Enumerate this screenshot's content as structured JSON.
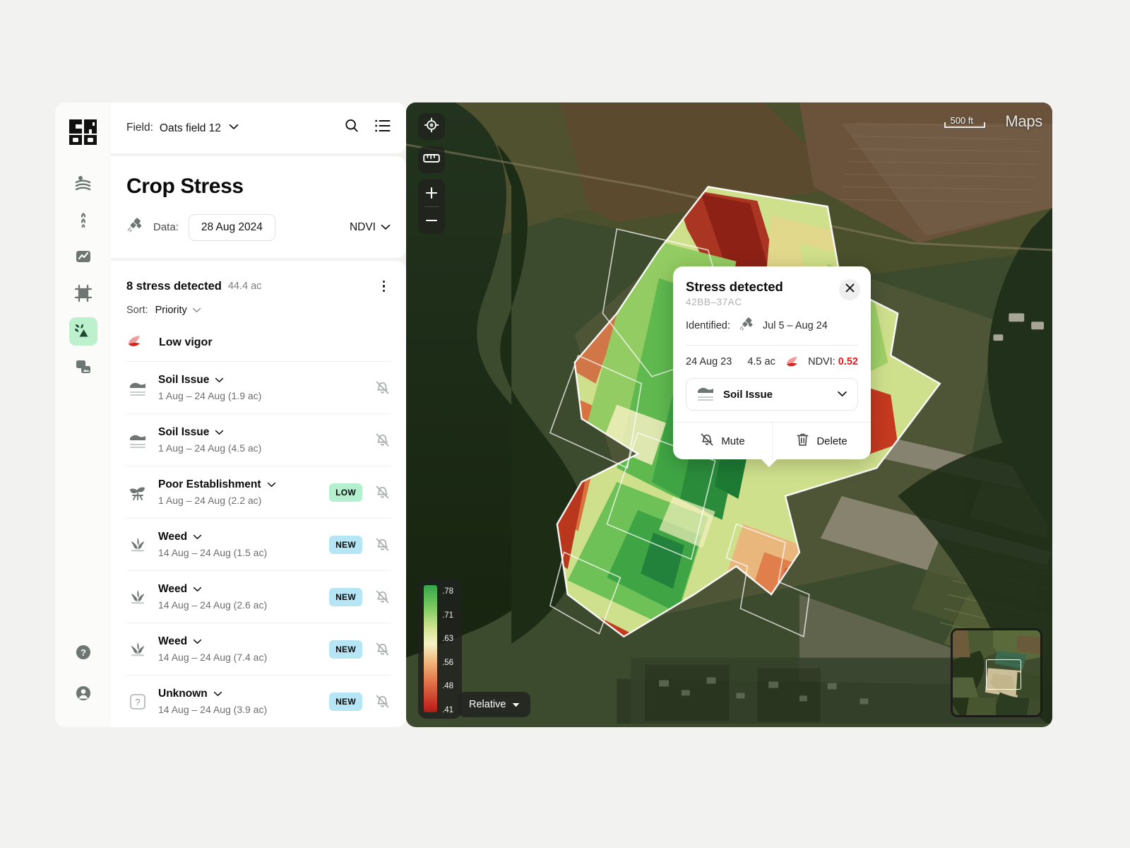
{
  "brand": {
    "logo_line1": "CR",
    "logo_line2": "OP"
  },
  "rail": {
    "items": [
      {
        "name": "fields",
        "icon": "field-rows-icon",
        "active": false
      },
      {
        "name": "crops",
        "icon": "crop-leaves-icon",
        "active": false
      },
      {
        "name": "analytics",
        "icon": "chart-line-icon",
        "active": false
      },
      {
        "name": "boundaries",
        "icon": "crop-frame-icon",
        "active": false
      },
      {
        "name": "crop-stress",
        "icon": "crop-stress-alert-icon",
        "active": true
      },
      {
        "name": "imagery",
        "icon": "layers-image-icon",
        "active": false
      }
    ],
    "bottom": [
      {
        "name": "help",
        "icon": "help-circle-icon"
      },
      {
        "name": "account",
        "icon": "user-circle-icon"
      }
    ]
  },
  "header": {
    "field_label": "Field:",
    "field_value": "Oats field 12",
    "search_icon": "search-icon",
    "list_icon": "list-view-icon"
  },
  "page": {
    "title": "Crop Stress",
    "data_label": "Data:",
    "satellite_icon": "satellite-icon",
    "date_value": "28 Aug 2024",
    "index_value": "NDVI"
  },
  "summary": {
    "count_text": "8 stress detected",
    "area_text": "44.4 ac",
    "sort_label": "Sort:",
    "sort_value": "Priority",
    "menu_icon": "kebab-menu-icon"
  },
  "group": {
    "label": "Low vigor",
    "icon": "low-vigor-leaf-icon"
  },
  "list": [
    {
      "icon": "soil-issue-icon",
      "title": "Soil Issue",
      "sub": "1 Aug – 24 Aug (1.9 ac)",
      "badge": "",
      "badge_kind": "",
      "bell": "bell-muted-icon"
    },
    {
      "icon": "soil-issue-icon",
      "title": "Soil Issue",
      "sub": "1 Aug – 24 Aug (4.5 ac)",
      "badge": "",
      "badge_kind": "",
      "bell": "bell-muted-icon"
    },
    {
      "icon": "poor-establishment-icon",
      "title": "Poor Establishment",
      "sub": "1 Aug – 24 Aug (2.2 ac)",
      "badge": "LOW",
      "badge_kind": "low",
      "bell": "bell-muted-icon"
    },
    {
      "icon": "weed-icon",
      "title": "Weed",
      "sub": "14 Aug – 24 Aug (1.5 ac)",
      "badge": "NEW",
      "badge_kind": "new",
      "bell": "bell-muted-icon"
    },
    {
      "icon": "weed-icon",
      "title": "Weed",
      "sub": "14 Aug – 24 Aug (2.6 ac)",
      "badge": "NEW",
      "badge_kind": "new",
      "bell": "bell-muted-icon"
    },
    {
      "icon": "weed-icon",
      "title": "Weed",
      "sub": "14 Aug – 24 Aug (7.4 ac)",
      "badge": "NEW",
      "badge_kind": "new",
      "bell": "bell-muted-icon"
    },
    {
      "icon": "unknown-icon",
      "title": "Unknown",
      "sub": "14 Aug – 24 Aug (3.9 ac)",
      "badge": "NEW",
      "badge_kind": "new",
      "bell": "bell-muted-icon"
    }
  ],
  "map": {
    "locate_icon": "locate-target-icon",
    "measure_icon": "ruler-icon",
    "zoom_in": "+",
    "zoom_out": "−",
    "scale_text": "500 ft",
    "attribution": "Maps",
    "mode_value": "Relative",
    "legend_ticks": [
      ".78",
      ".71",
      ".63",
      ".56",
      ".48",
      ".41"
    ],
    "legend_colors": [
      "#35a54a",
      "#79c95f",
      "#cfe38f",
      "#f6f2c6",
      "#f0b97e",
      "#e2744a",
      "#c42a21"
    ]
  },
  "popup": {
    "title": "Stress detected",
    "code": "42BB–37AC",
    "identified_label": "Identified:",
    "identified_icon": "satellite-icon",
    "identified_range": "Jul 5 – Aug 24",
    "stat_date": "24 Aug 23",
    "stat_area": "4.5 ac",
    "ndvi_label": "NDVI:",
    "ndvi_value": "0.52",
    "ndvi_icon": "low-vigor-leaf-icon",
    "category_icon": "soil-issue-icon",
    "category_value": "Soil Issue",
    "mute_label": "Mute",
    "mute_icon": "bell-muted-icon",
    "delete_label": "Delete",
    "delete_icon": "trash-icon",
    "close_icon": "close-icon"
  },
  "colors": {
    "accent_active": "#bdf0cd",
    "badge_low": "#b3f0cf",
    "badge_new": "#b6e6f5",
    "ndvi_alert": "#e01b1b"
  }
}
